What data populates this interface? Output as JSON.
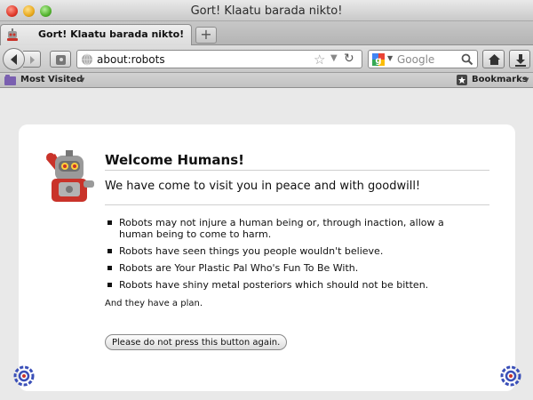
{
  "window": {
    "title": "Gort! Klaatu barada nikto!"
  },
  "tabs": [
    {
      "label": "Gort! Klaatu barada nikto!",
      "active": true
    }
  ],
  "toolbar": {
    "url": "about:robots",
    "search_placeholder": "Google",
    "new_tab_symbol": "+"
  },
  "bookmarks": {
    "most_visited": "Most Visited",
    "bookmarks_label": "Bookmarks"
  },
  "page": {
    "heading": "Welcome Humans!",
    "subheading": "We have come to visit you in peace and with goodwill!",
    "laws": [
      "Robots may not injure a human being or, through inaction, allow a human being to come to harm.",
      "Robots have seen things you people wouldn't believe.",
      "Robots are Your Plastic Pal Who's Fun To Be With.",
      "Robots have shiny metal posteriors which should not be bitten."
    ],
    "plan": "And they have a plan.",
    "button_label": "Please do not press this button again."
  },
  "icons": {
    "tab_favicon": "robot-icon",
    "back": "back-arrow-icon",
    "forward": "forward-arrow-icon",
    "home": "home-icon",
    "downloads": "download-icon",
    "decor": "gear-icon"
  },
  "colors": {
    "robot_red": "#c9332a",
    "robot_gray": "#9a9a9a",
    "gear_blue": "#3a4fb8"
  }
}
